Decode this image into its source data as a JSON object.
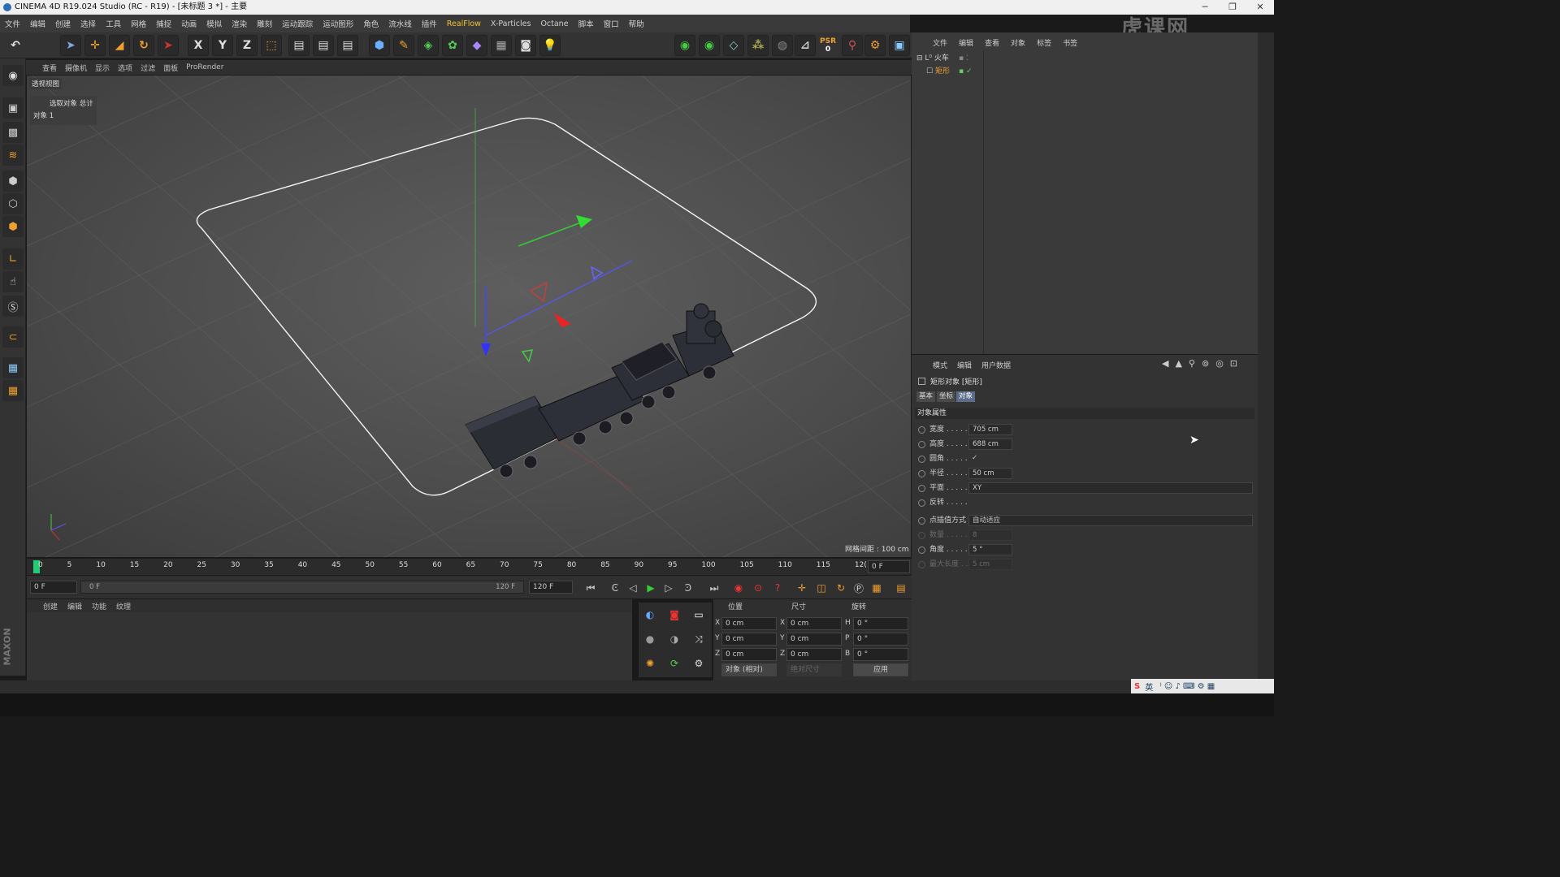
{
  "window": {
    "title": "CINEMA 4D R19.024 Studio (RC - R19) - [未标题 3 *] - 主要",
    "controls": [
      "─",
      "❐",
      "✕"
    ]
  },
  "menubar": [
    "文件",
    "编辑",
    "创建",
    "选择",
    "工具",
    "网格",
    "捕捉",
    "动画",
    "模拟",
    "渲染",
    "雕刻",
    "运动跟踪",
    "运动图形",
    "角色",
    "流水线",
    "插件",
    "RealFlow",
    "X-Particles",
    "Octane",
    "脚本",
    "窗口",
    "帮助"
  ],
  "toolbar": {
    "undo": "↶",
    "x": "X",
    "y": "Y",
    "z": "Z",
    "psr_label": "PSR",
    "psr_value": "0"
  },
  "viewport": {
    "menu": [
      "查看",
      "摄像机",
      "显示",
      "选项",
      "过滤",
      "面板",
      "ProRender"
    ],
    "label": "透视视图",
    "hud_line1": "选取对象 总计",
    "hud_line2": "对象  1",
    "grid_info": "网格间距 : 100 cm"
  },
  "timeline": {
    "ticks": [
      "0",
      "5",
      "10",
      "15",
      "20",
      "25",
      "30",
      "35",
      "40",
      "45",
      "50",
      "55",
      "60",
      "65",
      "70",
      "75",
      "80",
      "85",
      "90",
      "95",
      "100",
      "105",
      "110",
      "115",
      "12("
    ],
    "current_frame": "0 F",
    "start": "0 F",
    "range_start": "0 F",
    "range_end": "120 F",
    "end": "120 F"
  },
  "material_menu": [
    "创建",
    "编辑",
    "功能",
    "纹理"
  ],
  "coords": {
    "head_pos": "位置",
    "head_size": "尺寸",
    "head_rot": "旋转",
    "rows": [
      {
        "axis": "X",
        "pos": "0 cm",
        "saxis": "X",
        "size": "0 cm",
        "raxis": "H",
        "rot": "0 °"
      },
      {
        "axis": "Y",
        "pos": "0 cm",
        "saxis": "Y",
        "size": "0 cm",
        "raxis": "P",
        "rot": "0 °"
      },
      {
        "axis": "Z",
        "pos": "0 cm",
        "saxis": "Z",
        "size": "0 cm",
        "raxis": "B",
        "rot": "0 °"
      }
    ],
    "mode": "对象 (相对)",
    "size_mode": "绝对尺寸",
    "apply": "应用"
  },
  "object_manager": {
    "menu": [
      "文件",
      "编辑",
      "查看",
      "对象",
      "标签",
      "书签"
    ],
    "items": [
      {
        "name": "火车",
        "level": 0
      },
      {
        "name": "矩形",
        "level": 1
      }
    ]
  },
  "attributes": {
    "menu": [
      "模式",
      "编辑",
      "用户数据"
    ],
    "title": "矩形对象 [矩形]",
    "tabs": [
      "基本",
      "坐标",
      "对象"
    ],
    "section": "对象属性",
    "props": [
      {
        "label": "宽度 . . . . .",
        "value": "705 cm"
      },
      {
        "label": "高度 . . . . .",
        "value": "688 cm"
      },
      {
        "label": "圆角 . . . . .",
        "value": "✓"
      },
      {
        "label": "半径 . . . . .",
        "value": "50 cm"
      },
      {
        "label": "平面 . . . . .",
        "value": "XY"
      },
      {
        "label": "反转 . . . . .",
        "value": ""
      },
      {
        "label": "点插值方式",
        "value": "自动适应"
      },
      {
        "label": "数量 . . . . .",
        "value": "8"
      },
      {
        "label": "角度 . . . . .",
        "value": "5 °"
      },
      {
        "label": "最大长度 . .",
        "value": "5 cm"
      }
    ]
  },
  "watermark": "虎课网",
  "ime": "英"
}
